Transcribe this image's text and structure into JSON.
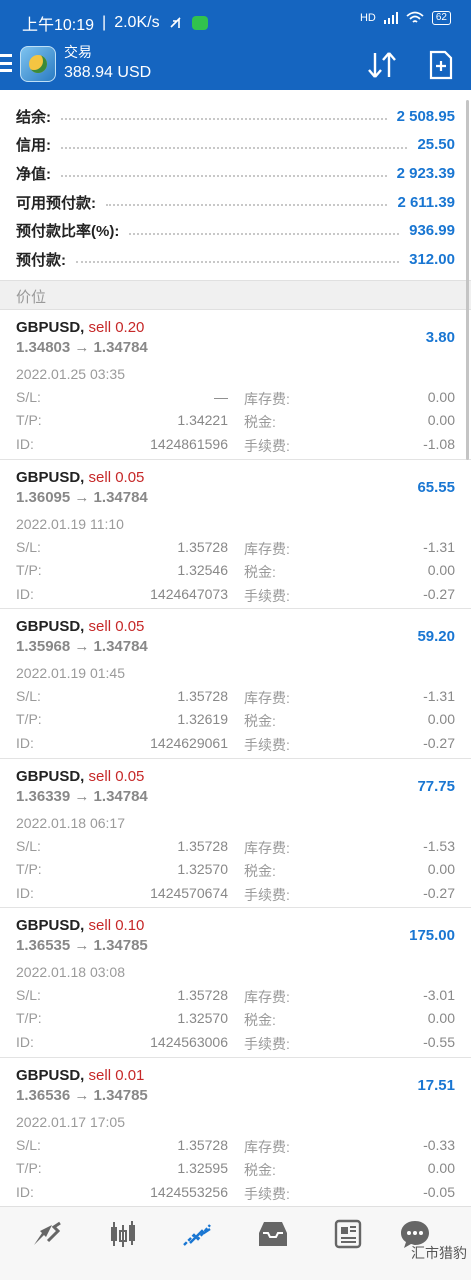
{
  "status_bar": {
    "time": "上午10:19",
    "separator": "|",
    "net_speed": "2.0K/s",
    "signal": "HD",
    "battery": "62"
  },
  "header": {
    "title": "交易",
    "balance": "388.94 USD"
  },
  "summary": [
    {
      "label": "结余:",
      "value": "2 508.95"
    },
    {
      "label": "信用:",
      "value": "25.50"
    },
    {
      "label": "净值:",
      "value": "2 923.39"
    },
    {
      "label": "可用预付款:",
      "value": "2 611.39"
    },
    {
      "label": "预付款比率(%):",
      "value": "936.99"
    },
    {
      "label": "预付款:",
      "value": "312.00"
    }
  ],
  "section_label": "价位",
  "detail_labels": {
    "sl": "S/L:",
    "tp": "T/P:",
    "id": "ID:",
    "swap": "库存费:",
    "tax": "税金:",
    "fee": "手续费:"
  },
  "positions": [
    {
      "symbol": "GBPUSD,",
      "side": "sell 0.20",
      "prices": "1.34803 → 1.34784",
      "profit": "3.80",
      "time": "2022.01.25 03:35",
      "sl": "—",
      "tp": "1.34221",
      "id": "1424861596",
      "swap": "0.00",
      "tax": "0.00",
      "fee": "-1.08"
    },
    {
      "symbol": "GBPUSD,",
      "side": "sell 0.05",
      "prices": "1.36095 → 1.34784",
      "profit": "65.55",
      "time": "2022.01.19 11:10",
      "sl": "1.35728",
      "tp": "1.32546",
      "id": "1424647073",
      "swap": "-1.31",
      "tax": "0.00",
      "fee": "-0.27"
    },
    {
      "symbol": "GBPUSD,",
      "side": "sell 0.05",
      "prices": "1.35968 → 1.34784",
      "profit": "59.20",
      "time": "2022.01.19 01:45",
      "sl": "1.35728",
      "tp": "1.32619",
      "id": "1424629061",
      "swap": "-1.31",
      "tax": "0.00",
      "fee": "-0.27"
    },
    {
      "symbol": "GBPUSD,",
      "side": "sell 0.05",
      "prices": "1.36339 → 1.34784",
      "profit": "77.75",
      "time": "2022.01.18 06:17",
      "sl": "1.35728",
      "tp": "1.32570",
      "id": "1424570674",
      "swap": "-1.53",
      "tax": "0.00",
      "fee": "-0.27"
    },
    {
      "symbol": "GBPUSD,",
      "side": "sell 0.10",
      "prices": "1.36535 → 1.34785",
      "profit": "175.00",
      "time": "2022.01.18 03:08",
      "sl": "1.35728",
      "tp": "1.32570",
      "id": "1424563006",
      "swap": "-3.01",
      "tax": "0.00",
      "fee": "-0.55"
    },
    {
      "symbol": "GBPUSD,",
      "side": "sell 0.01",
      "prices": "1.36536 → 1.34785",
      "profit": "17.51",
      "time": "2022.01.17 17:05",
      "sl": "1.35728",
      "tp": "1.32595",
      "id": "1424553256",
      "swap": "-0.33",
      "tax": "0.00",
      "fee": "-0.05"
    }
  ],
  "bottom_nav": [
    "quotes-icon",
    "chart-icon",
    "trade-icon",
    "history-icon",
    "news-icon",
    "messages-icon"
  ],
  "watermark": "汇市猎豹",
  "colors": {
    "primary": "#1565c0",
    "value_blue": "#1976d2",
    "sell_red": "#c62828"
  }
}
